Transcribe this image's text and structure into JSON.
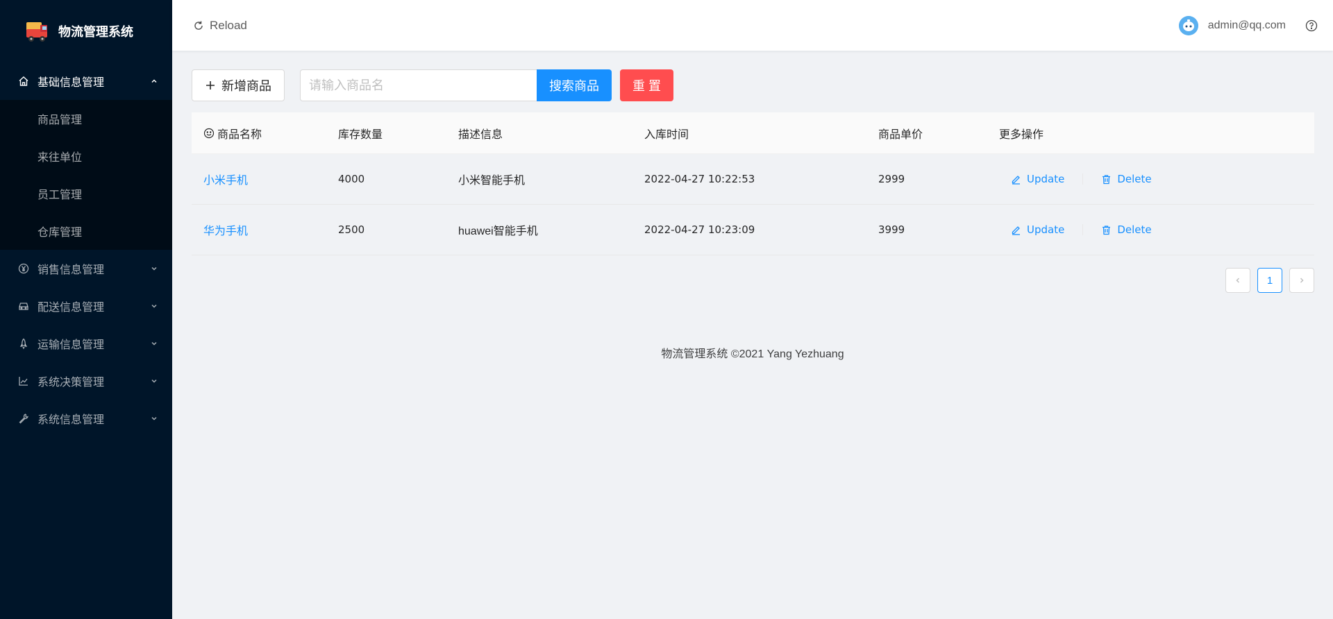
{
  "app": {
    "title": "物流管理系统"
  },
  "sidebar": {
    "groups": [
      {
        "label": "基础信息管理",
        "icon": "home-icon",
        "open": true,
        "items": [
          {
            "label": "商品管理"
          },
          {
            "label": "来往单位"
          },
          {
            "label": "员工管理"
          },
          {
            "label": "仓库管理"
          }
        ]
      },
      {
        "label": "销售信息管理",
        "icon": "yen-icon"
      },
      {
        "label": "配送信息管理",
        "icon": "car-icon"
      },
      {
        "label": "运输信息管理",
        "icon": "rocket-icon"
      },
      {
        "label": "系统决策管理",
        "icon": "line-chart-icon"
      },
      {
        "label": "系统信息管理",
        "icon": "tool-icon"
      }
    ]
  },
  "header": {
    "reload_label": "Reload",
    "user_email": "admin@qq.com"
  },
  "toolbar": {
    "add_label": "新增商品",
    "search_placeholder": "请输入商品名",
    "search_value": "",
    "search_label": "搜索商品",
    "reset_label": "重 置"
  },
  "table": {
    "columns": [
      "商品名称",
      "库存数量",
      "描述信息",
      "入库时间",
      "商品单价",
      "更多操作"
    ],
    "rows": [
      {
        "name": "小米手机",
        "stock": "4000",
        "desc": "小米智能手机",
        "time": "2022-04-27 10:22:53",
        "price": "2999"
      },
      {
        "name": "华为手机",
        "stock": "2500",
        "desc": "huawei智能手机",
        "time": "2022-04-27 10:23:09",
        "price": "3999"
      }
    ],
    "update_label": "Update",
    "delete_label": "Delete"
  },
  "pagination": {
    "current": "1"
  },
  "footer": {
    "text": "物流管理系统 ©2021 Yang Yezhuang"
  },
  "colors": {
    "sider": "#001529",
    "primary": "#1890ff",
    "danger": "#ff4d4f"
  }
}
